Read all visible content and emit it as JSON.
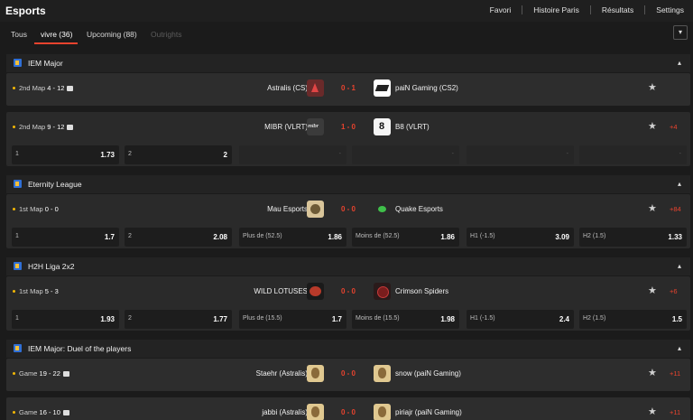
{
  "header": {
    "title": "Esports",
    "nav": [
      "Favori",
      "Histoire Paris",
      "Résultats",
      "Settings"
    ]
  },
  "tabs": [
    {
      "label": "Tous",
      "state": "normal"
    },
    {
      "label": "vivre (36)",
      "state": "active"
    },
    {
      "label": "Upcoming (88)",
      "state": "normal"
    },
    {
      "label": "Outrights",
      "state": "disabled"
    }
  ],
  "colors": {
    "accent": "#e8432e",
    "live_dot": "#f2b705",
    "background": "#1b1b1b",
    "card": "#2d2d2d"
  },
  "sections": [
    {
      "league": "IEM Major",
      "matches": [
        {
          "status": "2nd Map",
          "map_score": "4 - 12",
          "home": "Astralis (CS)",
          "home_logo": "astralis-logo",
          "score": "0 - 1",
          "away": "paiN Gaming (CS2)",
          "away_logo": "pain-logo",
          "more": "",
          "odds": []
        },
        {
          "status": "2nd Map",
          "map_score": "9 - 12",
          "home": "MIBR (VLRT)",
          "home_logo": "mibr-logo",
          "score": "1 - 0",
          "away": "B8 (VLRT)",
          "away_logo": "b8-logo",
          "more": "+4",
          "odds": [
            {
              "label": "1",
              "value": "1.73"
            },
            {
              "label": "2",
              "value": "2"
            },
            {
              "label": "",
              "value": "-"
            },
            {
              "label": "",
              "value": "-"
            },
            {
              "label": "",
              "value": "-"
            },
            {
              "label": "",
              "value": "-"
            }
          ]
        }
      ]
    },
    {
      "league": "Eternity League",
      "matches": [
        {
          "status": "1st Map",
          "map_score": "0 - 0",
          "home": "Mau Esports",
          "home_logo": "mau-logo",
          "score": "0 - 0",
          "away": "Quake Esports",
          "away_logo": "quake-logo",
          "more": "+84",
          "odds": [
            {
              "label": "1",
              "value": "1.7"
            },
            {
              "label": "2",
              "value": "2.08"
            },
            {
              "label": "Plus de (52.5)",
              "value": "1.86"
            },
            {
              "label": "Moins de (52.5)",
              "value": "1.86"
            },
            {
              "label": "H1 (-1.5)",
              "value": "3.09"
            },
            {
              "label": "H2 (1.5)",
              "value": "1.33"
            }
          ]
        }
      ]
    },
    {
      "league": "H2H Liga 2x2",
      "matches": [
        {
          "status": "1st Map",
          "map_score": "5 - 3",
          "home": "WILD LOTUSES",
          "home_logo": "wild-lotuses-logo",
          "score": "0 - 0",
          "away": "Crimson Spiders",
          "away_logo": "crimson-spiders-logo",
          "more": "+6",
          "odds": [
            {
              "label": "1",
              "value": "1.93"
            },
            {
              "label": "2",
              "value": "1.77"
            },
            {
              "label": "Plus de (15.5)",
              "value": "1.7"
            },
            {
              "label": "Moins de (15.5)",
              "value": "1.98"
            },
            {
              "label": "H1 (-1.5)",
              "value": "2.4"
            },
            {
              "label": "H2 (1.5)",
              "value": "1.5"
            }
          ]
        }
      ]
    },
    {
      "league": "IEM Major: Duel of the players",
      "matches": [
        {
          "status": "Game",
          "map_score": "19 - 22",
          "home": "Staehr (Astralis)",
          "home_logo": "player-avatar",
          "score": "0 - 0",
          "away": "snow (paiN Gaming)",
          "away_logo": "player-avatar",
          "more": "+11",
          "odds": []
        },
        {
          "status": "Game",
          "map_score": "16 - 10",
          "home": "jabbi (Astralis)",
          "home_logo": "player-avatar",
          "score": "0 - 0",
          "away": "piriajr (paiN Gaming)",
          "away_logo": "player-avatar",
          "more": "+11",
          "odds": []
        }
      ]
    }
  ]
}
